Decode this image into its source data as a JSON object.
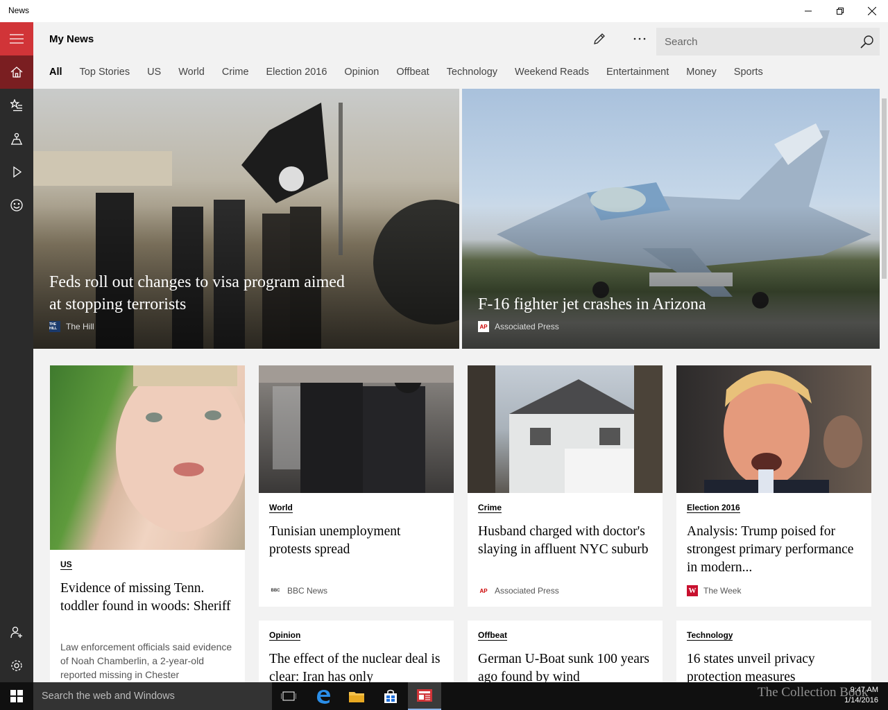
{
  "window": {
    "title": "News"
  },
  "header": {
    "title": "My News",
    "search_placeholder": "Search"
  },
  "tabs": [
    {
      "label": "All",
      "active": true
    },
    {
      "label": "Top Stories"
    },
    {
      "label": "US"
    },
    {
      "label": "World"
    },
    {
      "label": "Crime"
    },
    {
      "label": "Election 2016"
    },
    {
      "label": "Opinion"
    },
    {
      "label": "Offbeat"
    },
    {
      "label": "Technology"
    },
    {
      "label": "Weekend Reads"
    },
    {
      "label": "Entertainment"
    },
    {
      "label": "Money"
    },
    {
      "label": "Sports"
    }
  ],
  "hero": [
    {
      "headline": "Feds roll out changes to visa program aimed at stopping terrorists",
      "source": "The Hill"
    },
    {
      "headline": "F-16 fighter jet crashes in Arizona",
      "source": "Associated Press"
    }
  ],
  "cards": [
    {
      "category": "US",
      "title": "Evidence of missing Tenn. toddler found in woods: Sheriff",
      "snippet": "Law enforcement officials said evidence of Noah Chamberlin, a 2-year-old reported missing in Chester"
    },
    {
      "category": "World",
      "title": "Tunisian unemployment protests spread",
      "source": "BBC News"
    },
    {
      "category": "Crime",
      "title": "Husband charged with doctor's slaying in affluent NYC suburb",
      "source": "Associated Press"
    },
    {
      "category": "Election 2016",
      "title": "Analysis: Trump poised for strongest primary performance in modern...",
      "source": "The Week"
    },
    {
      "category": "Opinion",
      "title": "The effect of the nuclear deal is clear: Iran has only"
    },
    {
      "category": "Offbeat",
      "title": "German U-Boat sunk 100 years ago found by wind"
    },
    {
      "category": "Technology",
      "title": "16 states unveil privacy protection measures"
    }
  ],
  "logos": {
    "hill": "THE HILL",
    "ap": "AP",
    "bbc": "BBC",
    "week": "W"
  },
  "taskbar": {
    "search_placeholder": "Search the web and Windows",
    "time": "9:47 AM",
    "date": "1/14/2016"
  },
  "watermark": "The Collection Book",
  "colors": {
    "accent": "#d13438",
    "rail": "#2b2b2b",
    "taskbar": "#101010"
  }
}
